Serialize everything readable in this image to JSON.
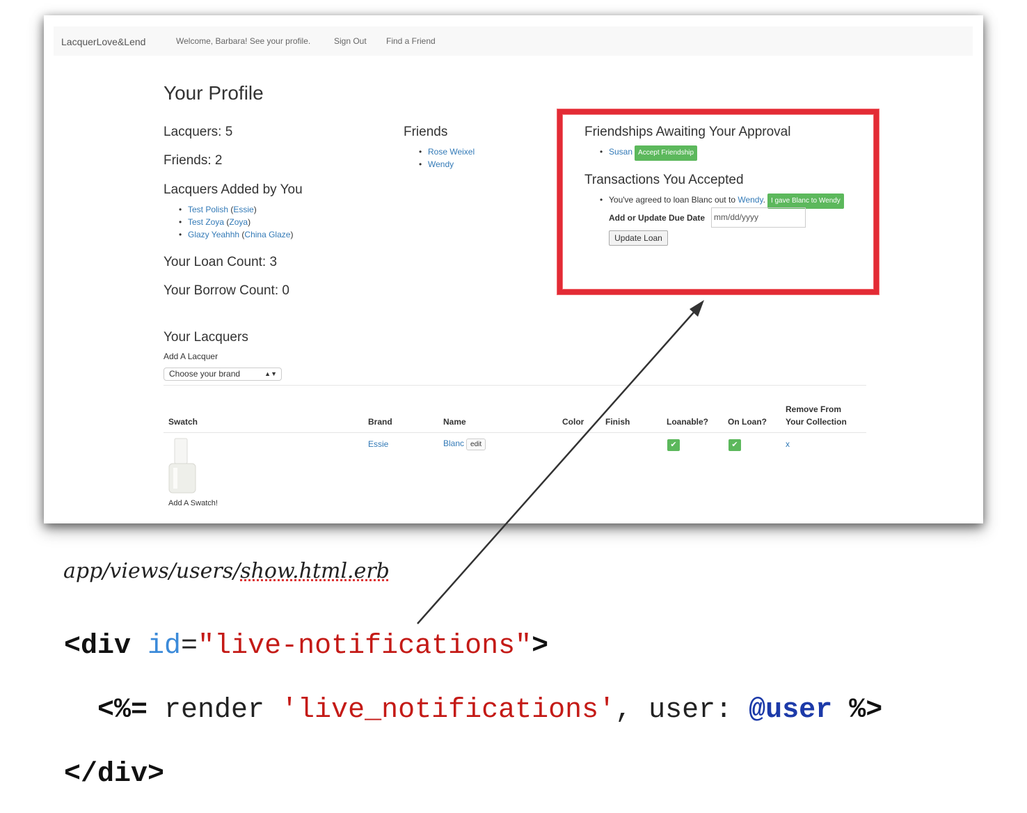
{
  "nav": {
    "brand": "LacquerLove&Lend",
    "welcome": "Welcome, Barbara! See your profile.",
    "sign_out": "Sign Out",
    "find_friend": "Find a Friend"
  },
  "profile": {
    "title": "Your Profile",
    "lacquers_count": "Lacquers: 5",
    "friends_count": "Friends: 2",
    "added_heading": "Lacquers Added by You",
    "added": [
      {
        "name": "Test Polish",
        "brand": "Essie"
      },
      {
        "name": "Test Zoya",
        "brand": "Zoya"
      },
      {
        "name": "Glazy Yeahhh",
        "brand": "China Glaze"
      }
    ],
    "loan_count": "Your Loan Count: 3",
    "borrow_count": "Your Borrow Count: 0"
  },
  "friends": {
    "heading": "Friends",
    "items": [
      "Rose Weixel",
      "Wendy"
    ]
  },
  "notifications": {
    "approval_heading": "Friendships Awaiting Your Approval",
    "pending_name": "Susan",
    "accept_button": "Accept Friendship",
    "transactions_heading": "Transactions You Accepted",
    "agreed_text": "You've agreed to loan Blanc out to",
    "agreed_friend": "Wendy",
    "agreed_period": ".",
    "gave_button": "I gave Blanc to Wendy",
    "due_label": "Add or Update Due Date",
    "due_placeholder": "mm/dd/yyyy",
    "update_button": "Update Loan",
    "highlight_color": "#e32b35"
  },
  "lacquers": {
    "heading": "Your Lacquers",
    "add_label": "Add A Lacquer",
    "brand_select": "Choose your brand",
    "columns": [
      "Swatch",
      "Brand",
      "Name",
      "Color",
      "Finish",
      "Loanable?",
      "On Loan?",
      "Remove From",
      "Your Collection"
    ],
    "row": {
      "brand": "Essie",
      "name": "Blanc",
      "edit": "edit",
      "loanable": "✔",
      "on_loan": "✔",
      "remove": "x",
      "add_swatch": "Add A Swatch!"
    }
  },
  "caption": {
    "path_a": "app/views/users/",
    "path_b": "show.html.erb"
  },
  "code": {
    "line1_open": "<div",
    "line1_attr": "id",
    "line1_eq": "=",
    "line1_val": "\"live-notifications\"",
    "line1_close": ">",
    "line2_open": "<%=",
    "line2_render": " render ",
    "line2_str": "'live_notifications'",
    "line2_user": ", user: ",
    "line2_ivar": "@user",
    "line2_close": "%>",
    "line3": "</div>"
  }
}
